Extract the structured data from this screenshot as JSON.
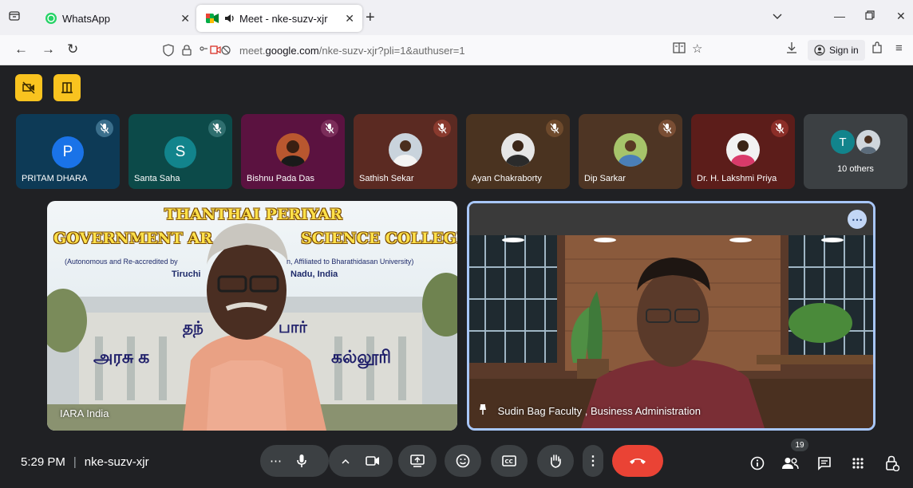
{
  "browser": {
    "tabs": [
      {
        "title": "WhatsApp",
        "icon": "whatsapp-icon",
        "active": false
      },
      {
        "title": "Meet - nke-suzv-xjr",
        "icon": "meet-icon",
        "audio": "speaker-icon",
        "active": true
      }
    ],
    "url": {
      "prefix": "meet.",
      "domain": "google.com",
      "path": "/nke-suzv-xjr?pli=1&authuser=1"
    },
    "sign_in_label": "Sign in"
  },
  "meet": {
    "participants": [
      {
        "name": "PRITAM DHARA",
        "initial": "P",
        "avatar_color": "#1a73e8",
        "tile_bg": "#0d3a56",
        "mic_color": "#3b6f8c"
      },
      {
        "name": "Santa Saha",
        "initial": "S",
        "avatar_color": "#12848c",
        "tile_bg": "#0c4a49",
        "mic_color": "#2f6f6f"
      },
      {
        "name": "Bishnu Pada Das",
        "tile_bg": "#5b1240",
        "mic_color": "#7b2d5a"
      },
      {
        "name": "Sathish Sekar",
        "tile_bg": "#5b2a22",
        "mic_color": "#8a3a2e"
      },
      {
        "name": "Ayan Chakraborty",
        "tile_bg": "#4a3320",
        "mic_color": "#6e4a2c"
      },
      {
        "name": "Dip Sarkar",
        "tile_bg": "#4e3524",
        "mic_color": "#7a4e34"
      },
      {
        "name": "Dr. H. Lakshmi Priya",
        "tile_bg": "#5c1d1a",
        "mic_color": "#8c2e28"
      }
    ],
    "others": {
      "label": "10 others",
      "initial": "T",
      "avatar_color": "#12848c"
    },
    "speaker_left": {
      "label": "IARA India",
      "banner_title_1": "THANTHAI PERIYAR",
      "banner_title_2_left": "GOVERNMENT AR",
      "banner_title_2_right": "SCIENCE COLLEGE",
      "banner_sub_left": "(Autonomous and Re-accredited by",
      "banner_sub_right": "n, Affiliated to Bharathidasan University)",
      "banner_city_left": "Tiruchi",
      "banner_city_right": "Nadu, India",
      "tamil_line_1_left": "தந்",
      "tamil_line_1_right": "பார்",
      "tamil_line_2_left": "அரசு க",
      "tamil_line_2_right": "கல்லூரி"
    },
    "speaker_right": {
      "label": "Sudin Bag Faculty , Business Administration"
    }
  },
  "bottom": {
    "time": "5:29 PM",
    "meeting_code": "nke-suzv-xjr",
    "people_count": "19"
  },
  "colors": {
    "accent_yellow": "#f9c31f",
    "leave_red": "#ea4335",
    "control_gray": "#3c4043",
    "pin_border": "#a8c7fa"
  }
}
